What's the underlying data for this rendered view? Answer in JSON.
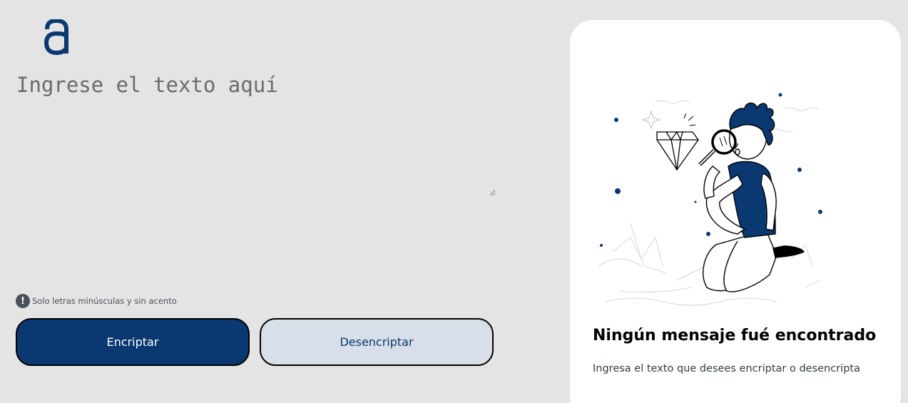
{
  "logo": {
    "icon": "alura-logo-icon",
    "color": "#0a3871"
  },
  "input": {
    "placeholder": "Ingrese el texto aquí",
    "value": ""
  },
  "hint": {
    "icon": "exclamation-icon",
    "text": "Solo letras minúsculas y sin acento"
  },
  "buttons": {
    "encrypt_label": "Encriptar",
    "decrypt_label": "Desencriptar"
  },
  "output": {
    "illustration": "person-magnifying-glass-illustration",
    "title": "Ningún mensaje fué encontrado",
    "subtitle": "Ingresa el texto que desees encriptar o desencripta"
  },
  "colors": {
    "background": "#e4e4e4",
    "primary": "#0a3871",
    "secondary_button": "#d8dfe8",
    "panel": "#ffffff"
  }
}
